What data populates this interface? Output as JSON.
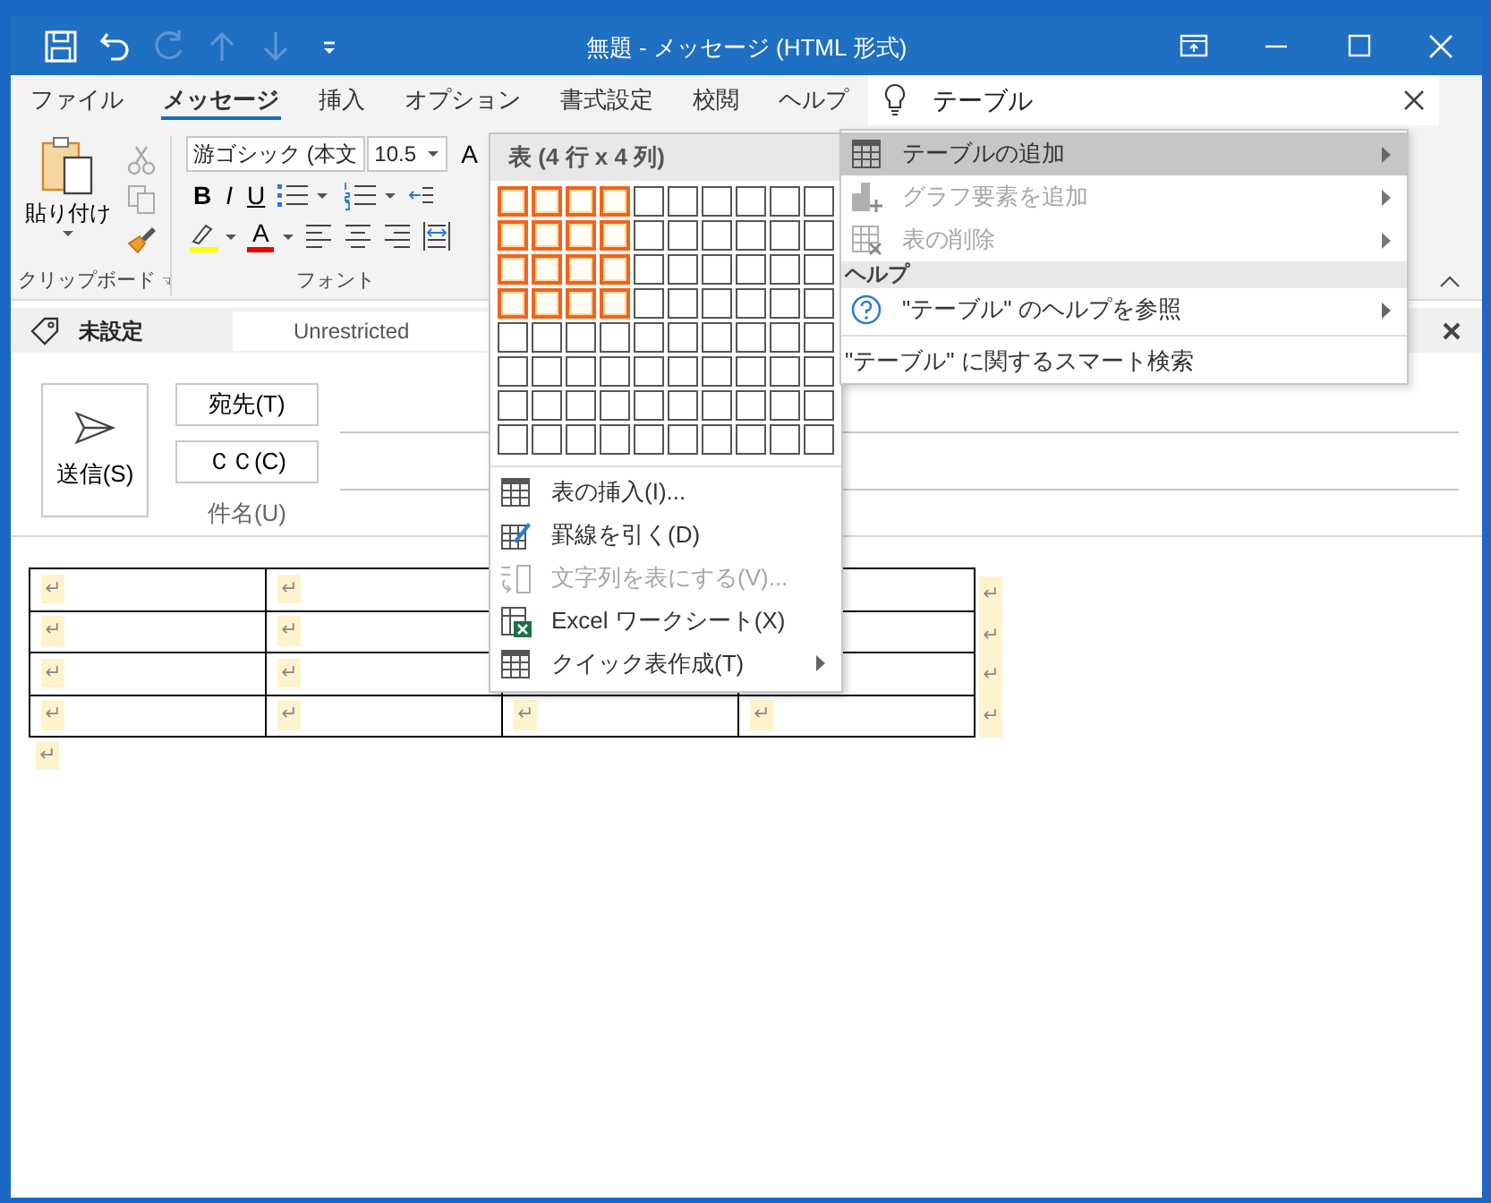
{
  "title_bar": {
    "quick_access": [
      {
        "kind": "save",
        "disabled": false
      },
      {
        "kind": "undo",
        "disabled": false
      },
      {
        "kind": "redo",
        "disabled": true
      },
      {
        "kind": "up",
        "disabled": true
      },
      {
        "kind": "down",
        "disabled": true
      },
      {
        "kind": "customize",
        "disabled": false
      }
    ],
    "title": "無題  -  メッセージ (HTML 形式)"
  },
  "ribbon_tabs": [
    {
      "label": "ファイル",
      "selected": false
    },
    {
      "label": "メッセージ",
      "selected": true
    },
    {
      "label": "挿入",
      "selected": false
    },
    {
      "label": "オプション",
      "selected": false
    },
    {
      "label": "書式設定",
      "selected": false
    },
    {
      "label": "校閲",
      "selected": false
    },
    {
      "label": "ヘルプ",
      "selected": false
    }
  ],
  "search": {
    "value": "テーブル"
  },
  "ribbon": {
    "clipboard": {
      "label": "クリップボード",
      "paste": "貼り付け"
    },
    "font": {
      "label": "フォント",
      "font_name": "游ゴシック (本文",
      "font_size": "10.5",
      "grow_font": "A",
      "format_buttons": [
        "B",
        "I",
        "U"
      ],
      "font_color": "A"
    }
  },
  "info_bar": {
    "label": "未設定",
    "field": "Unrestricted"
  },
  "compose": {
    "send": "送信(S)",
    "to": "宛先(T)",
    "cc": "ＣＣ(C)",
    "subject": "件名(U)"
  },
  "table": {
    "rows": [
      {
        "cells": [
          "↵",
          "↵"
        ],
        "end_mark": "↵"
      },
      {
        "cells": [
          "↵",
          "↵"
        ],
        "end_mark": "↵"
      },
      {
        "cells": [
          "↵",
          "↵"
        ],
        "end_mark": "↵"
      },
      {
        "cells": [
          "↵",
          "↵",
          "↵",
          "↵"
        ],
        "end_mark": "↵"
      }
    ],
    "after_mark": "↵"
  },
  "table_menu": {
    "title": "表 (4 行 x 4 列)",
    "grid": [
      {
        "cells": [
          {
            "selected": true
          },
          {
            "selected": true
          },
          {
            "selected": true
          },
          {
            "selected": true
          },
          {
            "selected": false
          },
          {
            "selected": false
          },
          {
            "selected": false
          },
          {
            "selected": false
          },
          {
            "selected": false
          },
          {
            "selected": false
          }
        ]
      },
      {
        "cells": [
          {
            "selected": true
          },
          {
            "selected": true
          },
          {
            "selected": true
          },
          {
            "selected": true
          },
          {
            "selected": false
          },
          {
            "selected": false
          },
          {
            "selected": false
          },
          {
            "selected": false
          },
          {
            "selected": false
          },
          {
            "selected": false
          }
        ]
      },
      {
        "cells": [
          {
            "selected": true
          },
          {
            "selected": true
          },
          {
            "selected": true
          },
          {
            "selected": true
          },
          {
            "selected": false
          },
          {
            "selected": false
          },
          {
            "selected": false
          },
          {
            "selected": false
          },
          {
            "selected": false
          },
          {
            "selected": false
          }
        ]
      },
      {
        "cells": [
          {
            "selected": true
          },
          {
            "selected": true
          },
          {
            "selected": true
          },
          {
            "selected": true
          },
          {
            "selected": false
          },
          {
            "selected": false
          },
          {
            "selected": false
          },
          {
            "selected": false
          },
          {
            "selected": false
          },
          {
            "selected": false
          }
        ]
      },
      {
        "cells": [
          {
            "selected": false
          },
          {
            "selected": false
          },
          {
            "selected": false
          },
          {
            "selected": false
          },
          {
            "selected": false
          },
          {
            "selected": false
          },
          {
            "selected": false
          },
          {
            "selected": false
          },
          {
            "selected": false
          },
          {
            "selected": false
          }
        ]
      },
      {
        "cells": [
          {
            "selected": false
          },
          {
            "selected": false
          },
          {
            "selected": false
          },
          {
            "selected": false
          },
          {
            "selected": false
          },
          {
            "selected": false
          },
          {
            "selected": false
          },
          {
            "selected": false
          },
          {
            "selected": false
          },
          {
            "selected": false
          }
        ]
      },
      {
        "cells": [
          {
            "selected": false
          },
          {
            "selected": false
          },
          {
            "selected": false
          },
          {
            "selected": false
          },
          {
            "selected": false
          },
          {
            "selected": false
          },
          {
            "selected": false
          },
          {
            "selected": false
          },
          {
            "selected": false
          },
          {
            "selected": false
          }
        ]
      },
      {
        "cells": [
          {
            "selected": false
          },
          {
            "selected": false
          },
          {
            "selected": false
          },
          {
            "selected": false
          },
          {
            "selected": false
          },
          {
            "selected": false
          },
          {
            "selected": false
          },
          {
            "selected": false
          },
          {
            "selected": false
          },
          {
            "selected": false
          }
        ]
      }
    ],
    "items": [
      {
        "kind": "insert-table",
        "label": "表の挿入(I)...",
        "disabled": false,
        "submenu": false
      },
      {
        "kind": "draw-table",
        "label": "罫線を引く(D)",
        "disabled": false,
        "submenu": false
      },
      {
        "kind": "text-to-table",
        "label": "文字列を表にする(V)...",
        "disabled": true,
        "submenu": false
      },
      {
        "kind": "excel",
        "label": "Excel ワークシート(X)",
        "disabled": false,
        "submenu": false
      },
      {
        "kind": "quick-table",
        "label": "クイック表作成(T)",
        "disabled": false,
        "submenu": true
      }
    ]
  },
  "search_menu": {
    "items": [
      {
        "kind": "table",
        "label": "テーブルの追加",
        "selected": true,
        "disabled": false,
        "submenu": true
      },
      {
        "kind": "chart",
        "label": "グラフ要素を追加",
        "selected": false,
        "disabled": true,
        "submenu": true
      },
      {
        "kind": "delete-table",
        "label": "表の削除",
        "selected": false,
        "disabled": true,
        "submenu": true
      },
      {
        "kind": "header",
        "label": "ヘルプ"
      },
      {
        "kind": "help",
        "label": "\"テーブル\" のヘルプを参照",
        "selected": false,
        "disabled": false,
        "submenu": true
      },
      {
        "kind": "plain",
        "label": "\"テーブル\" に関するスマート検索",
        "selected": false,
        "disabled": false,
        "submenu": false
      }
    ]
  }
}
